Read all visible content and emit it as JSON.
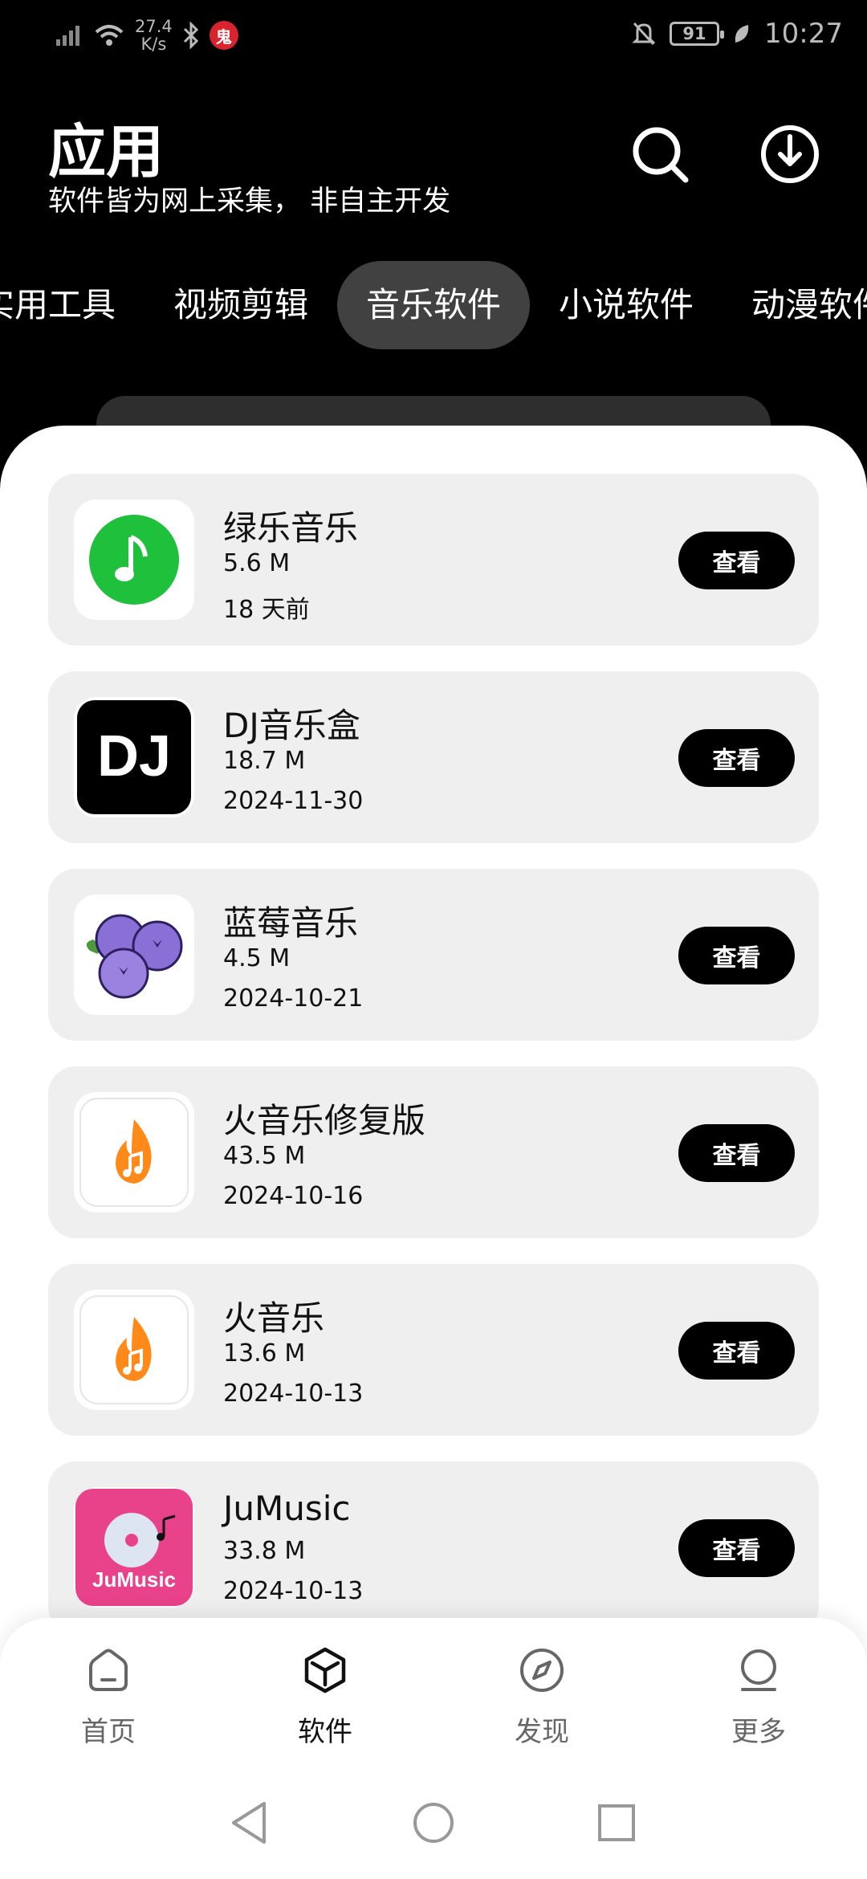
{
  "status_bar": {
    "net_speed_value": "27.4",
    "net_speed_unit": "K/s",
    "battery": "91",
    "time": "10:27",
    "badge_text": "鬼"
  },
  "header": {
    "title": "应用",
    "subtitle": "软件皆为网上采集， 非自主开发"
  },
  "tabs": [
    {
      "label": "实用工具"
    },
    {
      "label": "视频剪辑"
    },
    {
      "label": "音乐软件"
    },
    {
      "label": "小说软件"
    },
    {
      "label": "动漫软件"
    }
  ],
  "active_tab": "音乐软件",
  "apps": [
    {
      "name": "绿乐音乐",
      "size": "5.6 M",
      "date": "18 天前",
      "button": "查看",
      "icon": "music-note-icon"
    },
    {
      "name": "DJ音乐盒",
      "size": "18.7 M",
      "date": "2024-11-30",
      "button": "查看",
      "icon": "dj-logo-icon",
      "icon_text": "DJ"
    },
    {
      "name": "蓝莓音乐",
      "size": "4.5 M",
      "date": "2024-10-21",
      "button": "查看",
      "icon": "blueberry-icon"
    },
    {
      "name": "火音乐修复版",
      "size": "43.5 M",
      "date": "2024-10-16",
      "button": "查看",
      "icon": "flame-music-icon"
    },
    {
      "name": "火音乐",
      "size": "13.6 M",
      "date": "2024-10-13",
      "button": "查看",
      "icon": "flame-music-icon"
    },
    {
      "name": "JuMusic",
      "size": "33.8 M",
      "date": "2024-10-13",
      "button": "查看",
      "icon": "jumusic-cd-icon",
      "icon_text": "JuMusic"
    }
  ],
  "bottom_nav": [
    {
      "label": "首页",
      "icon": "home-icon"
    },
    {
      "label": "软件",
      "icon": "cube-icon"
    },
    {
      "label": "发现",
      "icon": "compass-icon"
    },
    {
      "label": "更多",
      "icon": "user-icon"
    }
  ],
  "active_nav": "软件",
  "colors": {
    "background": "#000000",
    "card": "#efefef",
    "active_tab": "#414141",
    "green_icon": "#1fc13c",
    "jumusic_pink": "#e8428a",
    "flame_orange": "#ff8a1a"
  }
}
